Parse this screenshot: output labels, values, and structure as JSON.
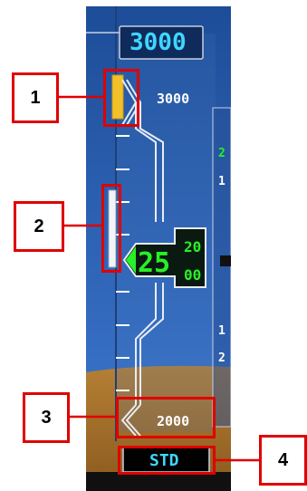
{
  "altitude_tape": {
    "selected_altitude": "3000",
    "upper_scale_label": "3000",
    "lower_scale_label": "2000",
    "current_altitude": {
      "prefix": "2",
      "hundreds": "25",
      "tens_upper": "20",
      "tens_lower": "00"
    },
    "baro_setting": "STD",
    "vsi_right_edge_digits": [
      "2",
      "1",
      "1",
      "2"
    ]
  },
  "callouts": {
    "c1": "1",
    "c2": "2",
    "c3": "3",
    "c4": "4"
  },
  "colors": {
    "sky_top": "#1f4f9a",
    "sky_bottom": "#3f7ad3",
    "ground": "#b27a2e",
    "selected_altitude_cyan": "#3fd6ff",
    "altitude_green": "#28f028",
    "target_amber": "#f2c02a",
    "callout_red": "#e00000"
  }
}
